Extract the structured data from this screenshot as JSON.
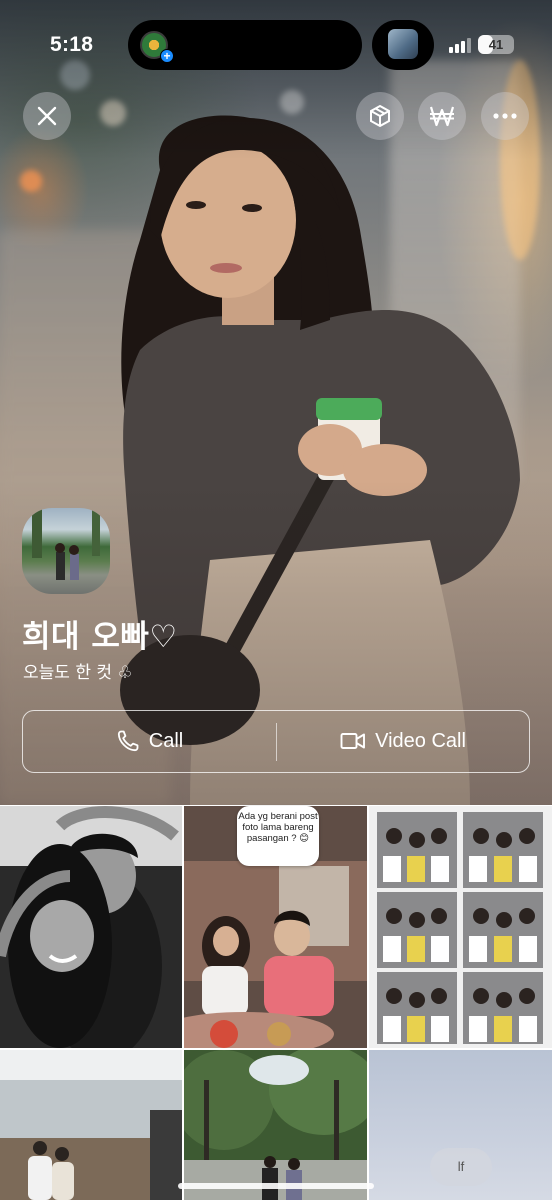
{
  "status_bar": {
    "time": "5:18",
    "battery": "41"
  },
  "top_actions": {
    "close_icon": "close-icon",
    "gift_icon": "gift-box-icon",
    "won_icon": "won-currency-icon",
    "more_icon": "more-icon"
  },
  "profile": {
    "name": "희대 오빠♡",
    "status_message": "오늘도 한 컷 ♧"
  },
  "actions": {
    "call_label": "Call",
    "video_call_label": "Video Call"
  },
  "grid": {
    "story_bubble_text": "Ada yg berani post foto lama bareng pasangan ? 😊"
  },
  "floating": {
    "lf_label": "lf"
  },
  "colors": {
    "accent_blue": "#1a8cff",
    "glass_button": "#d2d2d7"
  }
}
